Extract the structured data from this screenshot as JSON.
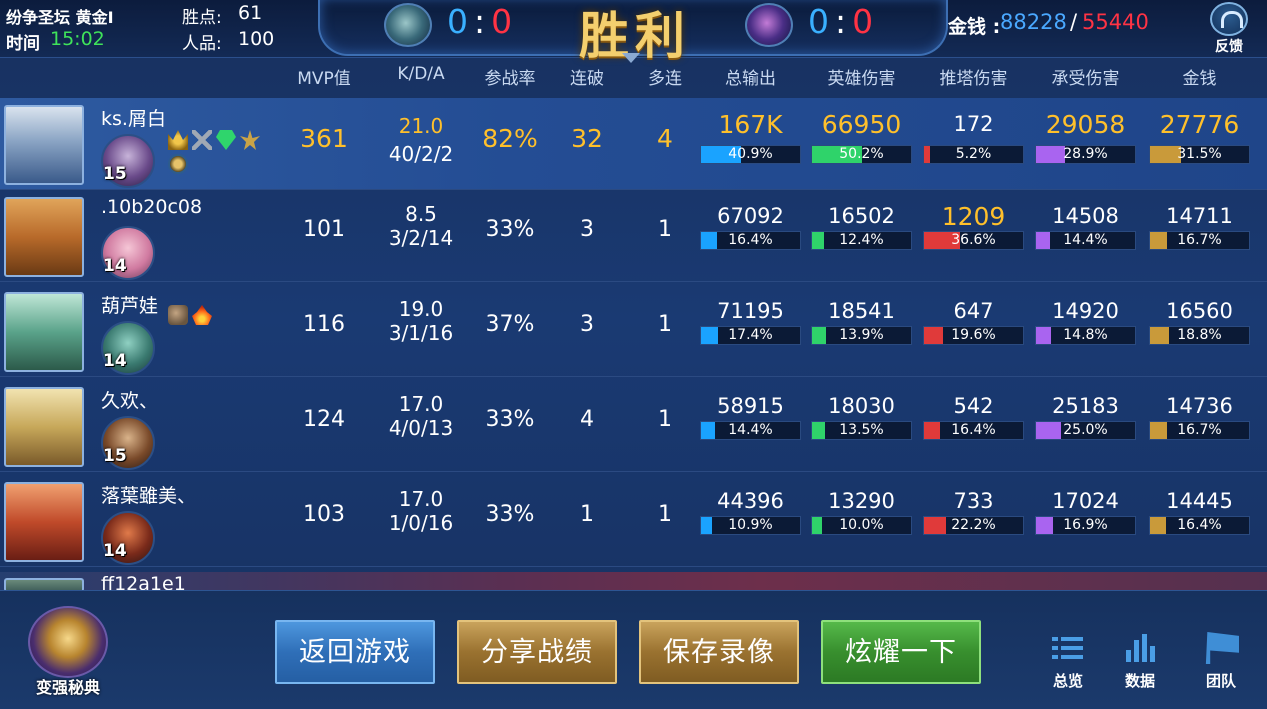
{
  "topbar": {
    "mode": "纷争圣坛 黄金I",
    "time_label": "时间",
    "time_value": "15:02",
    "wins_label": "胜点:",
    "wins_value": "61",
    "rep_label": "人品:",
    "rep_value": "100",
    "score_left": {
      "blue": "0",
      "sep": ":",
      "red": "0"
    },
    "result": "胜利",
    "score_right": {
      "blue": "0",
      "sep": ":",
      "red": "0"
    },
    "gold_label": "金钱 :",
    "gold_blue": "88228",
    "gold_sep": "/",
    "gold_red": "55440",
    "feedback_label": "反馈"
  },
  "columns": {
    "mvp": "MVP值",
    "kda": "K/D/A",
    "participation": "参战率",
    "streak": "连破",
    "multikill": "多连",
    "total_output": "总输出",
    "hero_damage": "英雄伤害",
    "tower_damage": "推塔伤害",
    "damage_taken": "承受伤害",
    "gold": "金钱"
  },
  "colors": {
    "output": "#1aa3ff",
    "hero": "#2fd36a",
    "tower": "#e03a3a",
    "taken": "#a964f0",
    "gold": "#c99a3a",
    "highlight": "#ffc02b"
  },
  "players": [
    {
      "name": "ks.屑白",
      "level": "15",
      "mvp": "361",
      "kda_score": "21.0",
      "kda": "40/2/2",
      "participation": "82%",
      "streak": "32",
      "multikill": "4",
      "output": "167K",
      "output_pct": "40.9%",
      "hero_dmg": "66950",
      "hero_pct": "50.2%",
      "tower_dmg": "172",
      "tower_pct": "5.2%",
      "taken": "29058",
      "taken_pct": "28.9%",
      "gold": "27776",
      "gold_pct": "31.5%",
      "highlights": [
        "output",
        "hero",
        "taken",
        "gold"
      ],
      "badges": [
        "crown",
        "swords",
        "gem",
        "wing",
        "medal"
      ]
    },
    {
      "name": ".10b20c08",
      "level": "14",
      "mvp": "101",
      "kda_score": "8.5",
      "kda": "3/2/14",
      "participation": "33%",
      "streak": "3",
      "multikill": "1",
      "output": "67092",
      "output_pct": "16.4%",
      "hero_dmg": "16502",
      "hero_pct": "12.4%",
      "tower_dmg": "1209",
      "tower_pct": "36.6%",
      "taken": "14508",
      "taken_pct": "14.4%",
      "gold": "14711",
      "gold_pct": "16.7%",
      "highlights": [
        "tower"
      ],
      "badges": []
    },
    {
      "name": "葫芦娃",
      "level": "14",
      "mvp": "116",
      "kda_score": "19.0",
      "kda": "3/1/16",
      "participation": "37%",
      "streak": "3",
      "multikill": "1",
      "output": "71195",
      "output_pct": "17.4%",
      "hero_dmg": "18541",
      "hero_pct": "13.9%",
      "tower_dmg": "647",
      "tower_pct": "19.6%",
      "taken": "14920",
      "taken_pct": "14.8%",
      "gold": "16560",
      "gold_pct": "18.8%",
      "highlights": [],
      "badges": [
        "fist",
        "fire"
      ]
    },
    {
      "name": "久欢、",
      "level": "15",
      "mvp": "124",
      "kda_score": "17.0",
      "kda": "4/0/13",
      "participation": "33%",
      "streak": "4",
      "multikill": "1",
      "output": "58915",
      "output_pct": "14.4%",
      "hero_dmg": "18030",
      "hero_pct": "13.5%",
      "tower_dmg": "542",
      "tower_pct": "16.4%",
      "taken": "25183",
      "taken_pct": "25.0%",
      "gold": "14736",
      "gold_pct": "16.7%",
      "highlights": [],
      "badges": []
    },
    {
      "name": "落葉雖美、",
      "level": "14",
      "mvp": "103",
      "kda_score": "17.0",
      "kda": "1/0/16",
      "participation": "33%",
      "streak": "1",
      "multikill": "1",
      "output": "44396",
      "output_pct": "10.9%",
      "hero_dmg": "13290",
      "hero_pct": "10.0%",
      "tower_dmg": "733",
      "tower_pct": "22.2%",
      "taken": "17024",
      "taken_pct": "16.9%",
      "gold": "14445",
      "gold_pct": "16.4%",
      "highlights": [],
      "badges": []
    }
  ],
  "partial_row_name": "ff12a1e1",
  "bottom": {
    "secret_label": "变强秘典",
    "btn_return": "返回游戏",
    "btn_share": "分享战绩",
    "btn_save": "保存录像",
    "btn_show": "炫耀一下",
    "nav_overview": "总览",
    "nav_data": "数据",
    "nav_team": "团队"
  }
}
